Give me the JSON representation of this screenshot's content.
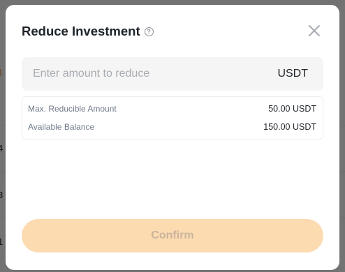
{
  "background": {
    "fragments": [
      "1",
      "4",
      "3",
      "1"
    ]
  },
  "modal": {
    "title": "Reduce Investment",
    "help_icon_glyph": "?",
    "close_icon": "close-icon",
    "amount": {
      "placeholder": "Enter amount to reduce",
      "value": "",
      "unit": "USDT"
    },
    "info": [
      {
        "label": "Max. Reducible Amount",
        "value": "50.00 USDT"
      },
      {
        "label": "Available Balance",
        "value": "150.00 USDT"
      }
    ],
    "confirm_label": "Confirm"
  },
  "colors": {
    "accent": "#f0b90b",
    "confirm_disabled_bg": "#fddbb1",
    "confirm_disabled_text": "#c9b49c"
  }
}
